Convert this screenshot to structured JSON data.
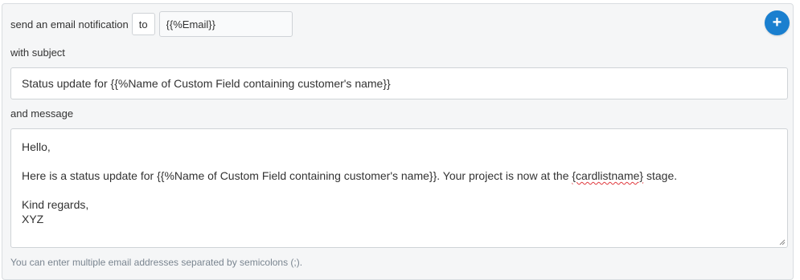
{
  "notify": {
    "prefix_label": "send an email notification",
    "to_label": "to",
    "email_value": "{{%Email}}"
  },
  "add_button": {
    "icon": "plus-icon",
    "glyph": "+",
    "color": "#1a7fcf"
  },
  "subject": {
    "label": "with subject",
    "value": "Status update for {{%Name of Custom Field containing customer's name}}"
  },
  "message": {
    "label": "and message",
    "lines": {
      "greeting": "Hello,",
      "body_before": "Here is a status update for {{%Name of Custom Field containing customer's name}}. Your project is now at the ",
      "body_placeholder": "{cardlistname}",
      "body_after": " stage.",
      "closing": "Kind regards,",
      "signature": "XYZ"
    }
  },
  "help_text": "You can enter multiple email addresses separated by semicolons (;)."
}
